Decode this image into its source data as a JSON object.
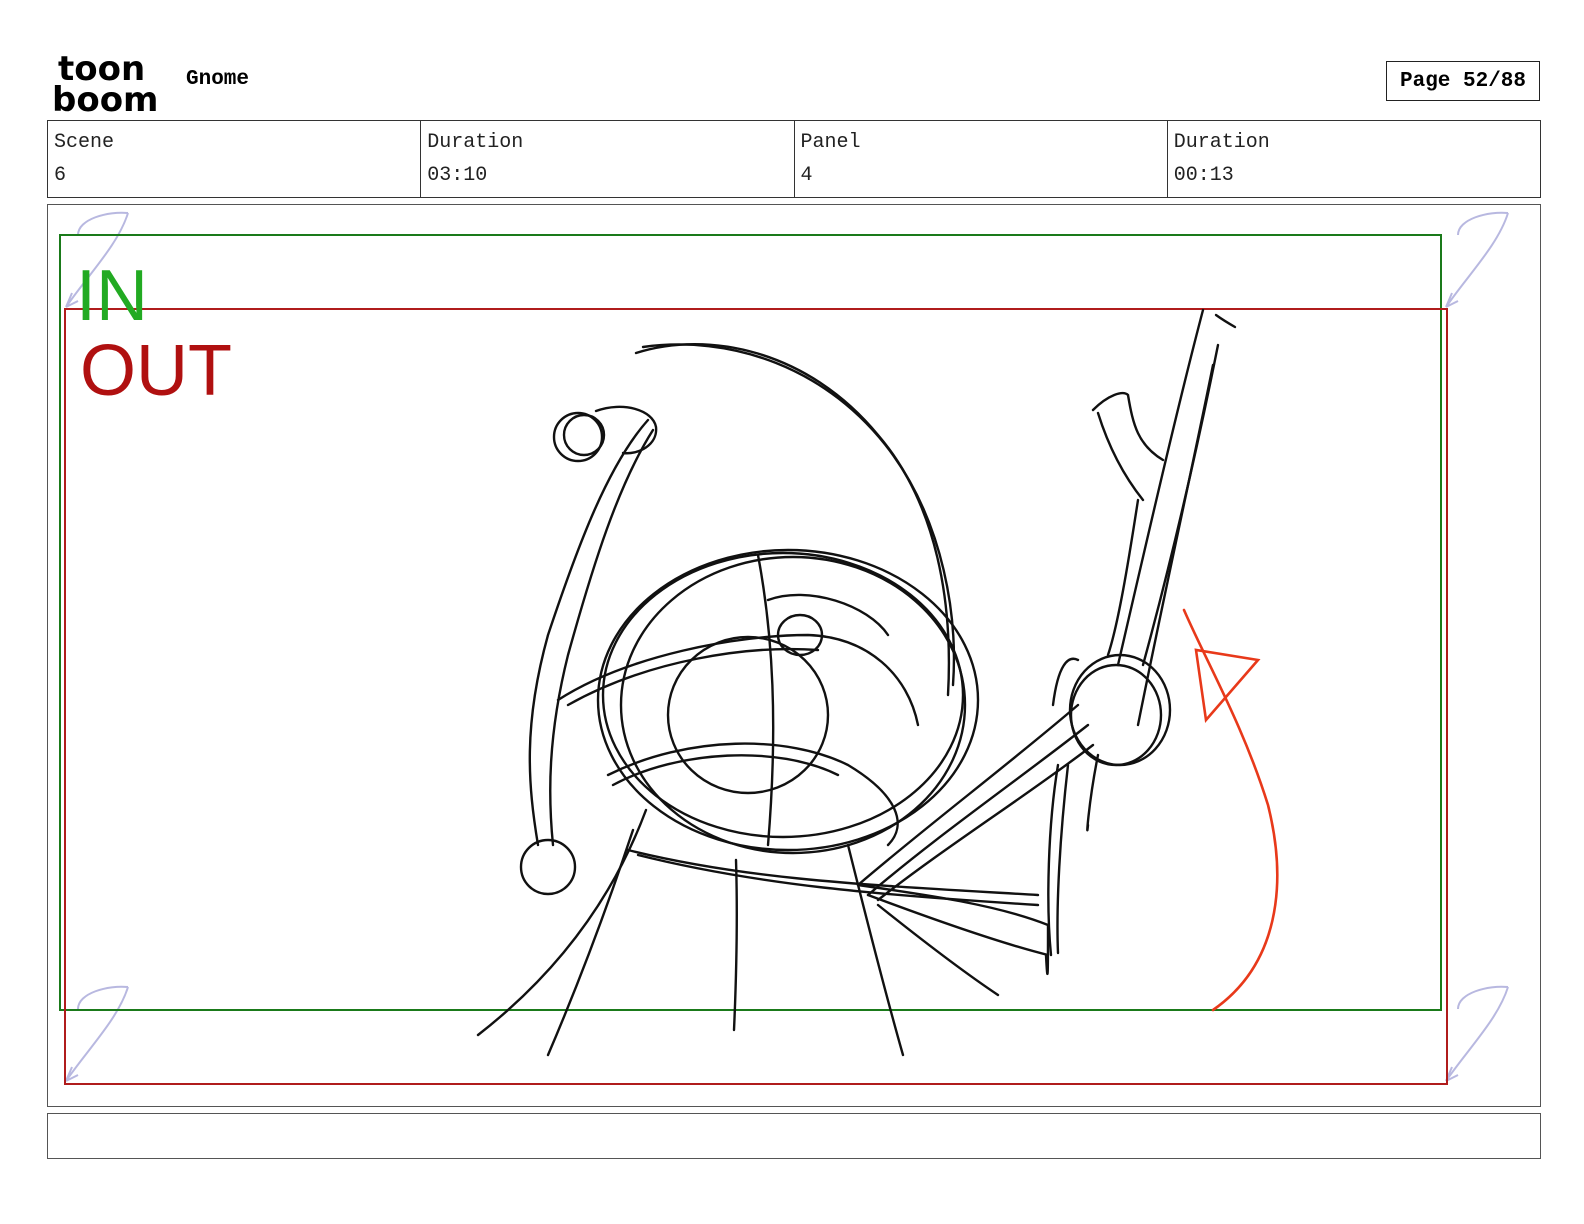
{
  "header": {
    "logo_line1": "toon",
    "logo_line2": "boom",
    "project_title": "Gnome",
    "page_label": "Page 52/88"
  },
  "info": [
    {
      "label": "Scene",
      "value": "6"
    },
    {
      "label": "Duration",
      "value": "03:10"
    },
    {
      "label": "Panel",
      "value": "4"
    },
    {
      "label": "Duration",
      "value": "00:13"
    }
  ],
  "panel": {
    "in_label": "IN",
    "out_label": "OUT",
    "colors": {
      "in_frame": "#1a7a1a",
      "in_text": "#22aa22",
      "out_frame": "#b01c1c",
      "out_text": "#b01010",
      "sketch": "#111111",
      "motion_arrow": "#e8391a",
      "corner_marks": "#b8b8e0"
    }
  },
  "notes": {
    "text": ""
  }
}
